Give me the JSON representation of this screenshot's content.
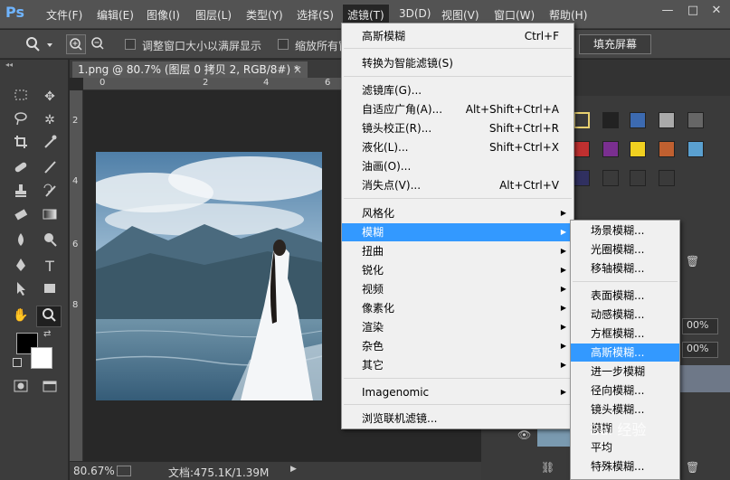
{
  "app": {
    "logo": "Ps"
  },
  "menubar": {
    "items": [
      "文件(F)",
      "编辑(E)",
      "图像(I)",
      "图层(L)",
      "类型(Y)",
      "选择(S)",
      "滤镜(T)",
      "3D(D)",
      "视图(V)",
      "窗口(W)",
      "帮助(H)"
    ],
    "active": "滤镜(T)"
  },
  "window_buttons": {
    "minimize": "—",
    "restore": "□",
    "close": "✕"
  },
  "options_bar": {
    "resize_window_label": "调整窗口大小以满屏显示",
    "zoom_all_label": "缩放所有窗",
    "fill_screen_label": "填充屏幕"
  },
  "document": {
    "tab_title": "1.png @ 80.7% (图层 0 拷贝 2, RGB/8#) *",
    "tab_close": "×",
    "ruler_top_ticks": [
      "0",
      "2",
      "4",
      "6"
    ],
    "ruler_left_ticks": [
      "2",
      "4",
      "6",
      "8"
    ]
  },
  "status": {
    "zoom": "80.67%",
    "doc_size": "文档:475.1K/1.39M"
  },
  "filter_menu": {
    "last_filter": {
      "label": "高斯模糊",
      "shortcut": "Ctrl+F"
    },
    "convert_smart": "转换为智能滤镜(S)",
    "group1": [
      {
        "label": "滤镜库(G)...",
        "shortcut": ""
      },
      {
        "label": "自适应广角(A)...",
        "shortcut": "Alt+Shift+Ctrl+A"
      },
      {
        "label": "镜头校正(R)...",
        "shortcut": "Shift+Ctrl+R"
      },
      {
        "label": "液化(L)...",
        "shortcut": "Shift+Ctrl+X"
      },
      {
        "label": "油画(O)...",
        "shortcut": ""
      },
      {
        "label": "消失点(V)...",
        "shortcut": "Alt+Ctrl+V"
      }
    ],
    "group2": [
      "风格化",
      "模糊",
      "扭曲",
      "锐化",
      "视频",
      "像素化",
      "渲染",
      "杂色",
      "其它"
    ],
    "highlighted": "模糊",
    "plugin": "Imagenomic",
    "browse_online": "浏览联机滤镜..."
  },
  "blur_submenu": {
    "group1": [
      "场景模糊...",
      "光圈模糊...",
      "移轴模糊..."
    ],
    "group2": [
      "表面模糊...",
      "动感模糊...",
      "方框模糊...",
      "高斯模糊...",
      "进一步模糊",
      "径向模糊...",
      "镜头模糊...",
      "模糊",
      "平均",
      "特殊模糊..."
    ],
    "highlighted": "高斯模糊..."
  },
  "panels": {
    "percent1": "00%",
    "percent2": "00%"
  },
  "watermark": "Bai 经验"
}
